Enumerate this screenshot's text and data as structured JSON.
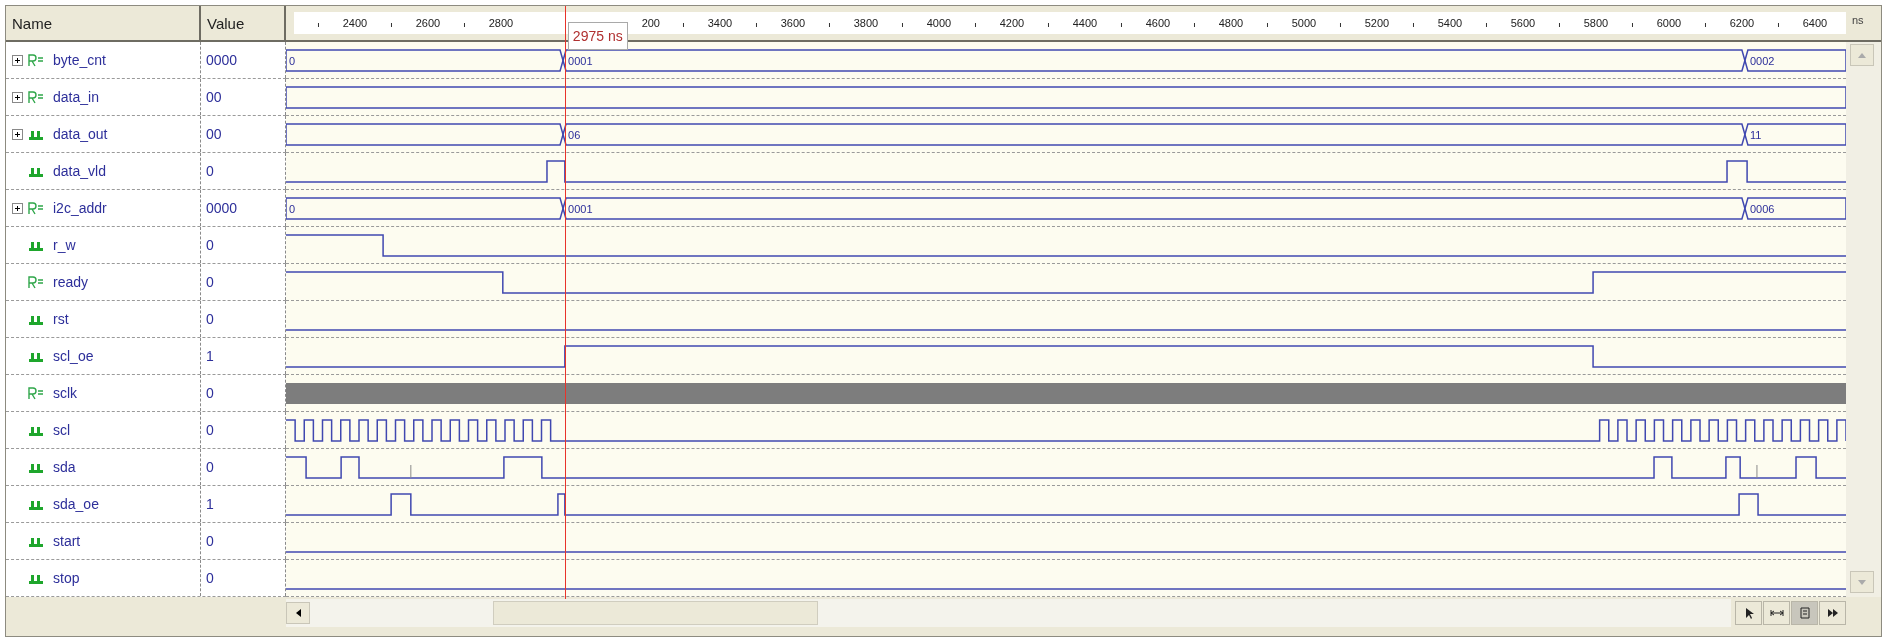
{
  "columns": {
    "name": "Name",
    "value": "Value"
  },
  "ruler": {
    "ticks_before_cursor": [
      "2400",
      "2600",
      "2800"
    ],
    "ticks_after_cursor": [
      "200",
      "3400",
      "3600",
      "3800",
      "4000",
      "4200",
      "4400",
      "4600",
      "4800",
      "5000",
      "5200",
      "5400",
      "5600",
      "5800",
      "6000",
      "6200",
      "6400"
    ],
    "unit": "ns"
  },
  "cursor": {
    "label": "2975 ns"
  },
  "signals": [
    {
      "name": "byte_cnt",
      "value": "0000",
      "register": true,
      "kind": "bus",
      "expanded": false,
      "labels": [
        "0",
        "0001",
        "0002"
      ]
    },
    {
      "name": "data_in",
      "value": "00",
      "register": true,
      "kind": "bus",
      "expanded": false
    },
    {
      "name": "data_out",
      "value": "00",
      "register": false,
      "kind": "bus",
      "expanded": false,
      "labels": [
        "06",
        "11"
      ]
    },
    {
      "name": "data_vld",
      "value": "0",
      "register": false,
      "kind": "bit"
    },
    {
      "name": "i2c_addr",
      "value": "0000",
      "register": true,
      "kind": "bus",
      "expanded": false,
      "labels": [
        "0",
        "0001",
        "0006"
      ]
    },
    {
      "name": "r_w",
      "value": "0",
      "register": false,
      "kind": "bit"
    },
    {
      "name": "ready",
      "value": "0",
      "register": true,
      "kind": "bit"
    },
    {
      "name": "rst",
      "value": "0",
      "register": false,
      "kind": "bit"
    },
    {
      "name": "scl_oe",
      "value": "1",
      "register": false,
      "kind": "bit"
    },
    {
      "name": "sclk",
      "value": "0",
      "register": true,
      "kind": "clock"
    },
    {
      "name": "scl",
      "value": "0",
      "register": false,
      "kind": "bit"
    },
    {
      "name": "sda",
      "value": "0",
      "register": false,
      "kind": "bit"
    },
    {
      "name": "sda_oe",
      "value": "1",
      "register": false,
      "kind": "bit"
    },
    {
      "name": "start",
      "value": "0",
      "register": false,
      "kind": "bit"
    },
    {
      "name": "stop",
      "value": "0",
      "register": false,
      "kind": "bit"
    }
  ]
}
